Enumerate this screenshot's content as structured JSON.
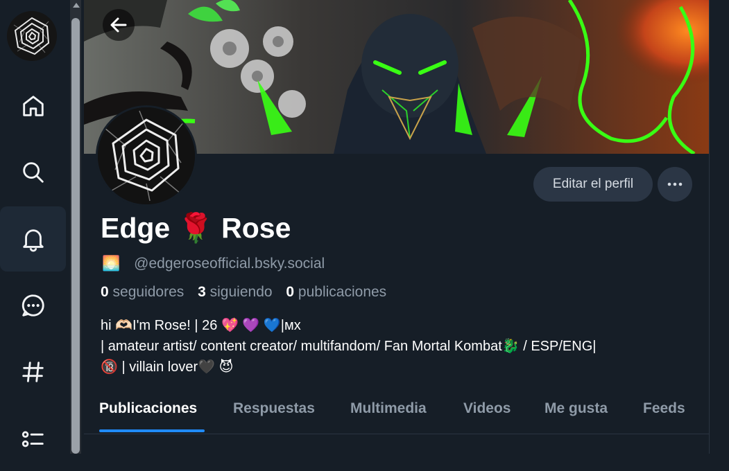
{
  "sidebar": {
    "items": [
      {
        "name": "home",
        "icon": "home-icon"
      },
      {
        "name": "search",
        "icon": "search-icon"
      },
      {
        "name": "notifications",
        "icon": "bell-icon"
      },
      {
        "name": "chat",
        "icon": "chat-icon"
      },
      {
        "name": "feeds",
        "icon": "hashtag-icon"
      },
      {
        "name": "lists",
        "icon": "list-icon"
      }
    ]
  },
  "profile": {
    "edit_label": "Editar el perfil",
    "name_part1": "Edge",
    "name_emoji": "🌹",
    "name_part2": "Rose",
    "handle_emoji": "🌅",
    "handle": "@edgeroseofficial.bsky.social",
    "stats": {
      "followers_count": "0",
      "followers_label": "seguidores",
      "following_count": "3",
      "following_label": "siguiendo",
      "posts_count": "0",
      "posts_label": "publicaciones"
    },
    "bio": [
      "hi 🫶🏻I'm Rose! | 26 💖 💜 💙|ᴍx",
      "| amateur artist/ content creator/ multifandom/ Fan Mortal Kombat🐉 / ESP/ENG|",
      "🔞 | villain lover🖤 😈"
    ]
  },
  "tabs": [
    {
      "label": "Publicaciones",
      "active": true
    },
    {
      "label": "Respuestas",
      "active": false
    },
    {
      "label": "Multimedia",
      "active": false
    },
    {
      "label": "Videos",
      "active": false
    },
    {
      "label": "Me gusta",
      "active": false
    },
    {
      "label": "Feeds",
      "active": false
    }
  ],
  "colors": {
    "background": "#161e27",
    "accent": "#208bfe",
    "muted_text": "#8f9ba8",
    "button_bg": "#2b3645",
    "banner_glow": "#39ff14"
  }
}
